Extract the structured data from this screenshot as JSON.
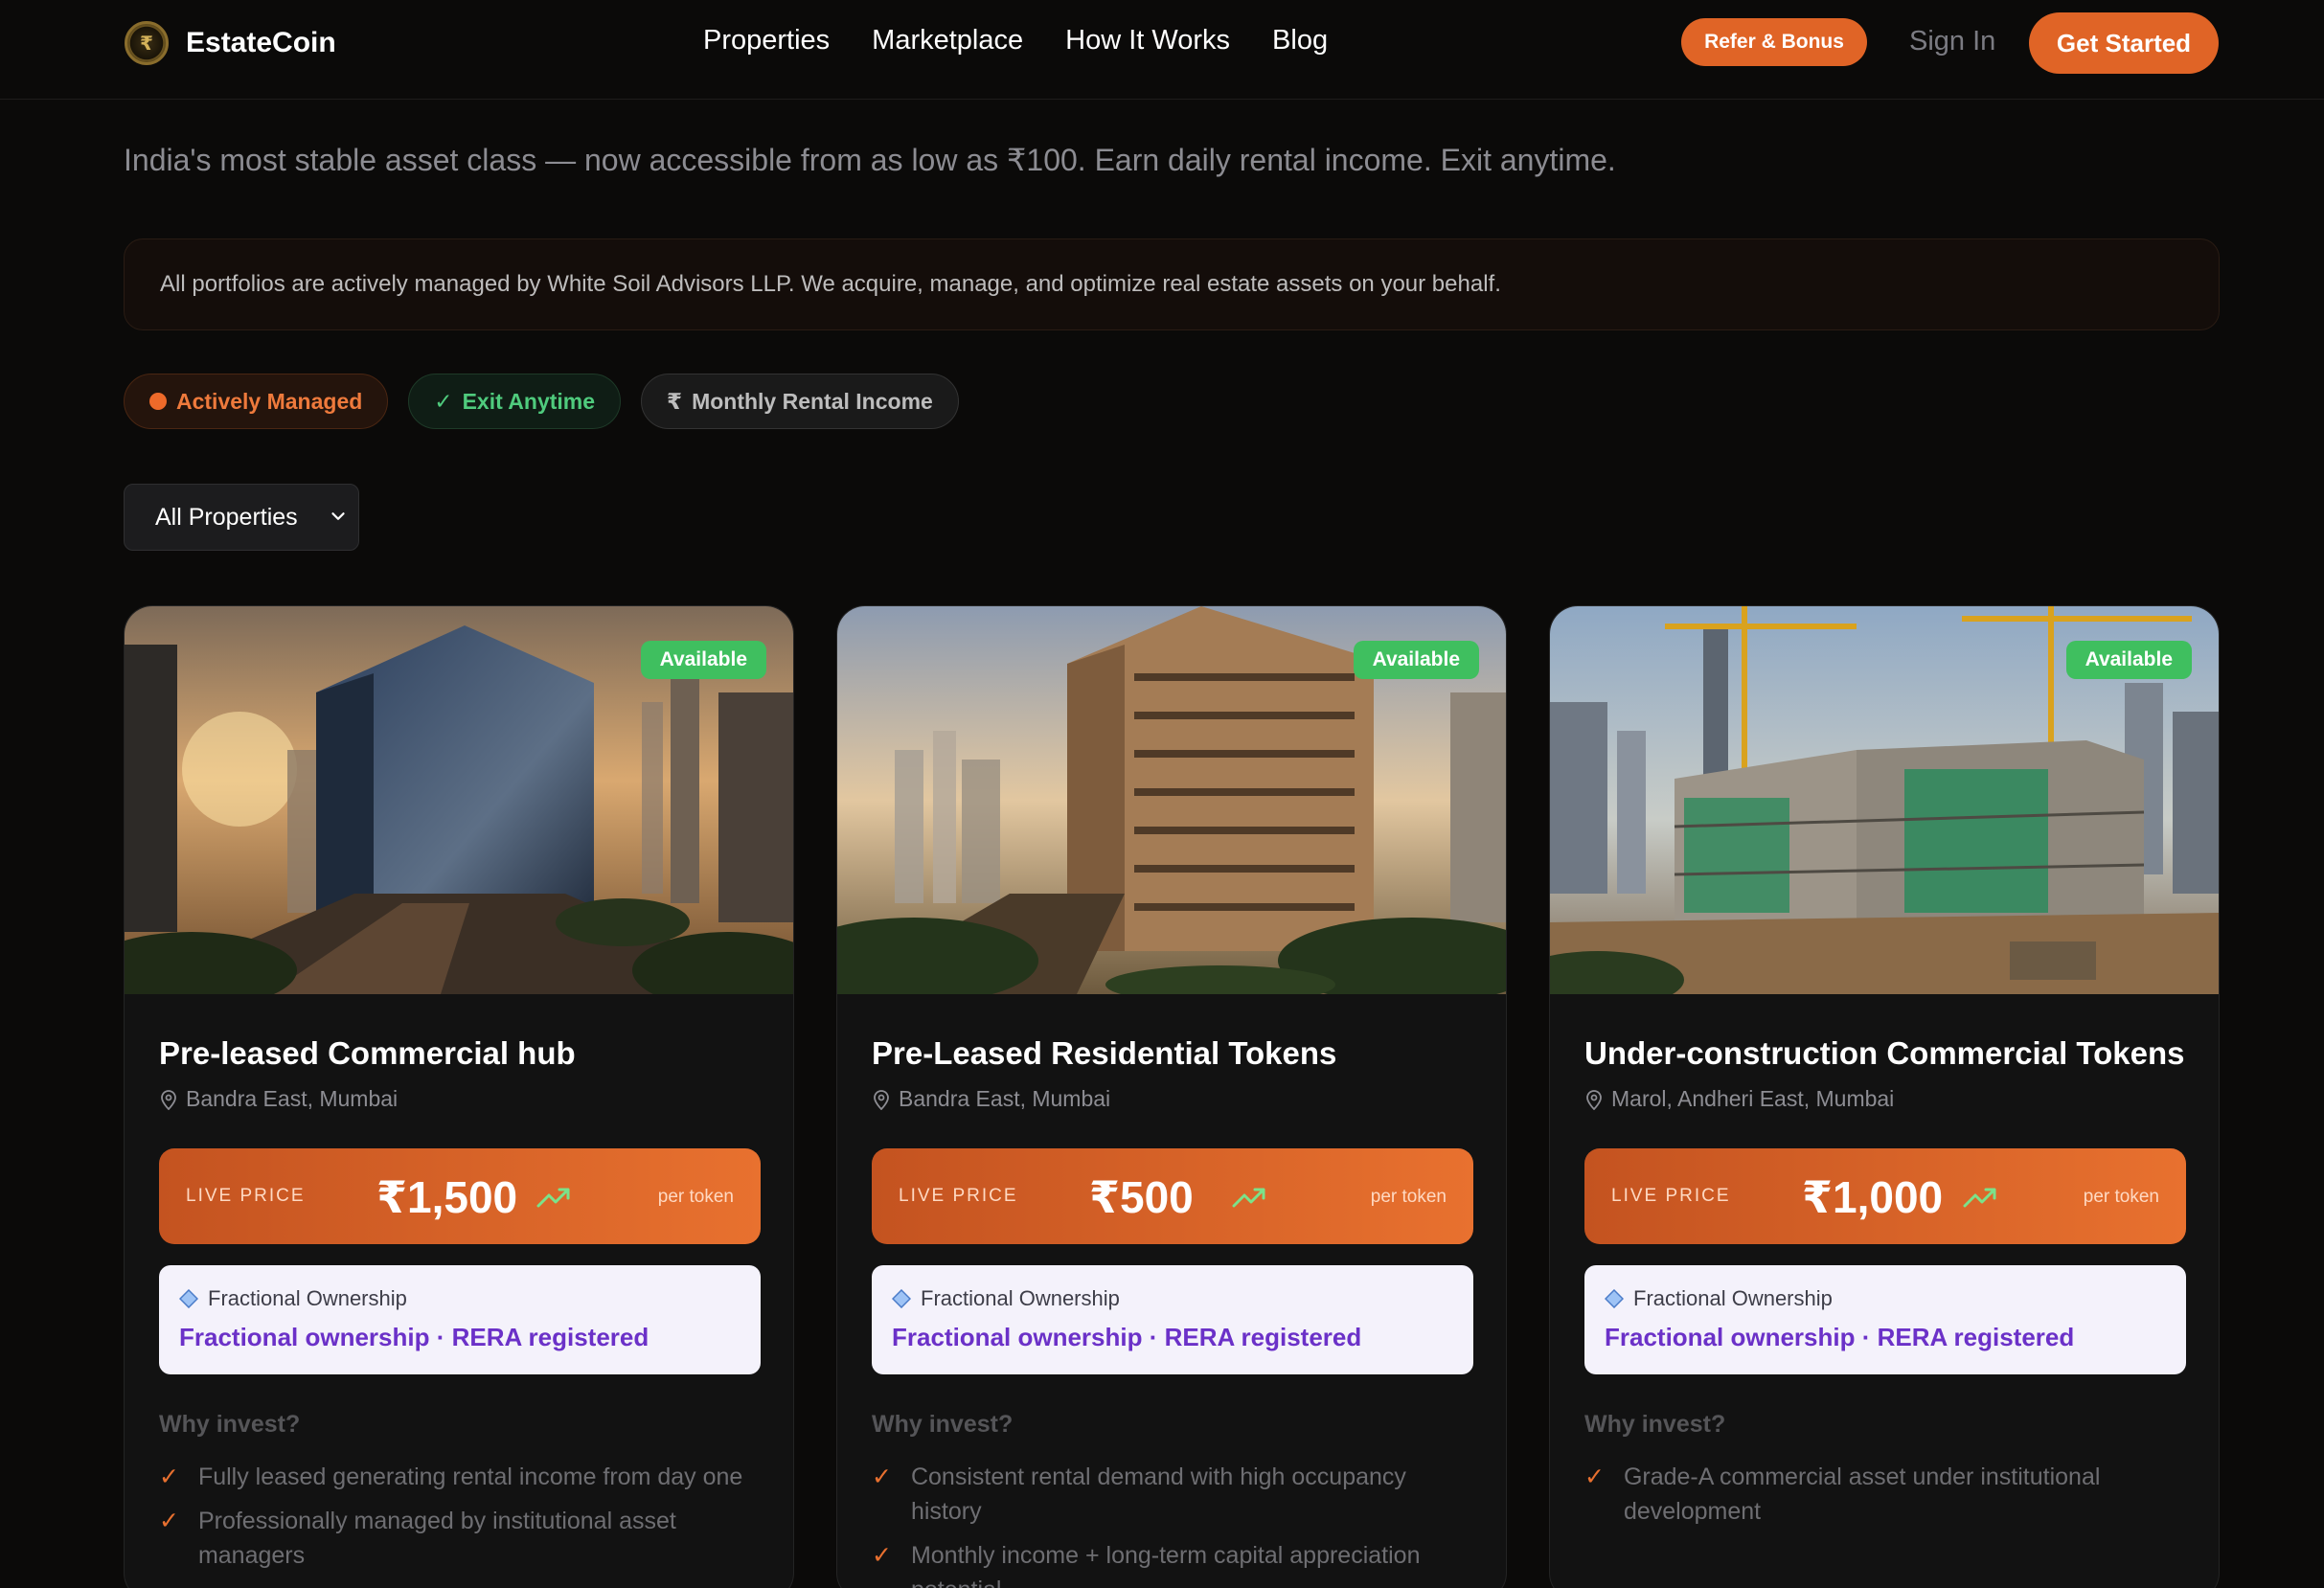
{
  "nav": {
    "brand": "EstateCoin",
    "links": [
      "Properties",
      "Marketplace",
      "How It Works",
      "Blog"
    ],
    "refer": "Refer & Bonus",
    "signin": "Sign In",
    "get_started": "Get Started"
  },
  "hero": {
    "tagline": "India's most stable asset class — now accessible from as low as ₹100. Earn daily rental income. Exit anytime.",
    "notice": "All portfolios are actively managed by White Soil Advisors LLP. We acquire, manage, and optimize real estate assets on your behalf.",
    "badges": {
      "managed": "Actively Managed",
      "exit": "Exit Anytime",
      "income": "Monthly Rental Income"
    }
  },
  "filter": {
    "selected": "All Properties"
  },
  "colors": {
    "accent": "#e06426",
    "available": "#3fbf5f",
    "ownership_text": "#6b31c8"
  },
  "cards": [
    {
      "status": "Available",
      "title": "Pre-leased Commercial hub",
      "location": "Bandra East, Mumbai",
      "price_label": "LIVE PRICE",
      "price": "₹1,500",
      "per": "per token",
      "ownership_label": "Fractional Ownership",
      "ownership_detail": "Fractional ownership · RERA registered",
      "why": "Why invest?",
      "points": [
        "Fully leased generating rental income from day one",
        "Professionally managed by institutional asset managers"
      ]
    },
    {
      "status": "Available",
      "title": "Pre-Leased Residential Tokens",
      "location": "Bandra East, Mumbai",
      "price_label": "LIVE PRICE",
      "price": "₹500",
      "per": "per token",
      "ownership_label": "Fractional Ownership",
      "ownership_detail": "Fractional ownership · RERA registered",
      "why": "Why invest?",
      "points": [
        "Consistent rental demand with high occupancy history",
        "Monthly income + long-term capital appreciation potential"
      ]
    },
    {
      "status": "Available",
      "title": "Under-construction Commercial Tokens",
      "location": "Marol, Andheri East, Mumbai",
      "price_label": "LIVE PRICE",
      "price": "₹1,000",
      "per": "per token",
      "ownership_label": "Fractional Ownership",
      "ownership_detail": "Fractional ownership · RERA registered",
      "why": "Why invest?",
      "points": [
        "Grade-A commercial asset under institutional development"
      ]
    }
  ]
}
